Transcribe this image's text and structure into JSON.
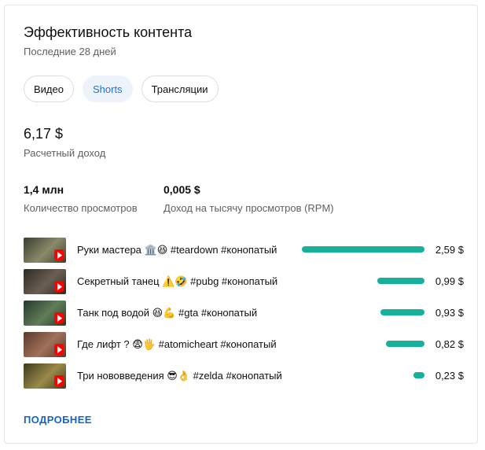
{
  "card": {
    "title": "Эффективность контента",
    "subtitle": "Последние 28 дней"
  },
  "tabs": [
    {
      "label": "Видео",
      "active": false
    },
    {
      "label": "Shorts",
      "active": true
    },
    {
      "label": "Трансляции",
      "active": false
    }
  ],
  "revenue": {
    "value": "6,17 $",
    "label": "Расчетный доход"
  },
  "metrics": [
    {
      "value": "1,4 млн",
      "label": "Количество просмотров"
    },
    {
      "value": "0,005 $",
      "label": "Доход на тысячу просмотров (RPM)"
    }
  ],
  "colors": {
    "bar": "#15b19a",
    "accent": "#1a73e8",
    "shorts_badge": "#ff0000"
  },
  "items": [
    {
      "title": "Руки мастера 🏛️😆 #teardown #конопатый",
      "value": "2,59 $",
      "amount": 2.59,
      "thumb": [
        "#3a3f2e",
        "#8a8a6a"
      ]
    },
    {
      "title": "Секретный танец ⚠️🤣 #pubg #конопатый",
      "value": "0,99 $",
      "amount": 0.99,
      "thumb": [
        "#2d2a26",
        "#6b5f52"
      ]
    },
    {
      "title": "Танк под водой 😆💪 #gta #конопатый",
      "value": "0,93 $",
      "amount": 0.93,
      "thumb": [
        "#263a2e",
        "#5f7d58"
      ]
    },
    {
      "title": "Где лифт ? 😨🖐️ #atomicheart #конопатый",
      "value": "0,82 $",
      "amount": 0.82,
      "thumb": [
        "#5a3a2e",
        "#a0705a"
      ]
    },
    {
      "title": "Три нововведения 😎👌 #zelda #конопатый",
      "value": "0,23 $",
      "amount": 0.23,
      "thumb": [
        "#3f3a1f",
        "#9a8a4a"
      ]
    }
  ],
  "more_label": "ПОДРОБНЕЕ"
}
